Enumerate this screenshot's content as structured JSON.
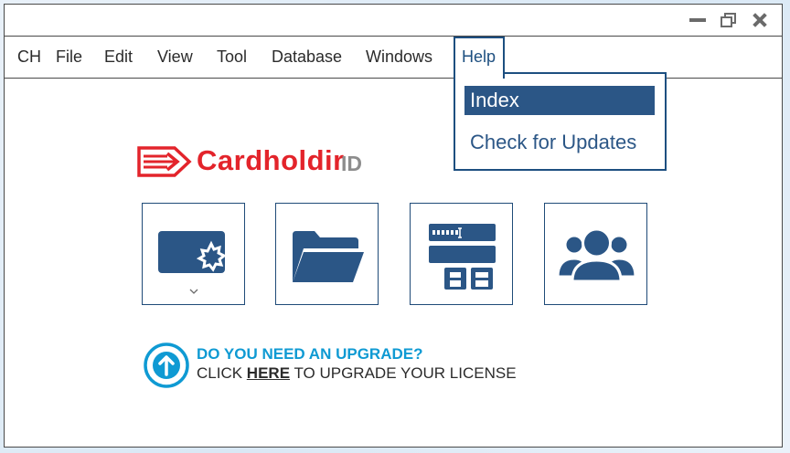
{
  "menu": {
    "items": [
      "CH",
      "File",
      "Edit",
      "View",
      "Tool",
      "Database",
      "Windows"
    ],
    "help": "Help"
  },
  "help_menu": {
    "items": [
      "Index",
      "Check for Updates"
    ],
    "selected": "Index"
  },
  "logo": {
    "name": "Cardholdir",
    "suffix": "ID"
  },
  "tiles": [
    {
      "icon": "id-card-badge-icon",
      "has_dropdown": true
    },
    {
      "icon": "folder-open-icon"
    },
    {
      "icon": "database-form-icon"
    },
    {
      "icon": "users-group-icon"
    }
  ],
  "upgrade": {
    "title": "DO YOU NEED AN UPGRADE?",
    "line_prefix": "CLICK ",
    "link": "HERE",
    "line_suffix": " TO UPGRADE YOUR LICENSE"
  },
  "colors": {
    "brand_red": "#e3242b",
    "navy": "#2b5686",
    "accent_blue": "#0f9ad3",
    "id_gray": "#8d8d8d"
  }
}
